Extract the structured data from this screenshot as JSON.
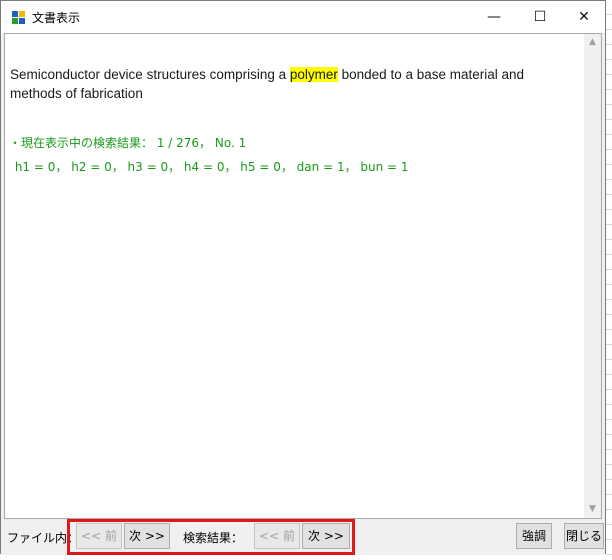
{
  "window": {
    "title": "文書表示",
    "minimize": "—",
    "maximize": "☐",
    "close": "✕"
  },
  "document": {
    "title_before": "Semiconductor device structures comprising a ",
    "title_highlight": "polymer",
    "title_after": " bonded to a base material and methods of fabrication",
    "status_line": "・現在表示中の検索結果： 1 / 276， No. 1",
    "counts_line": " h1 = 0， h2 = 0， h3 = 0， h4 = 0， h5 = 0， dan = 1， bun = 1"
  },
  "bottom": {
    "file_label": "ファイル内：",
    "file_prev": "<< 前",
    "file_next": "次 >>",
    "search_label": "検索結果：",
    "search_prev": "<< 前",
    "search_next": "次 >>",
    "emphasize": "強調",
    "close": "閉じる"
  },
  "colors": {
    "highlight": "#ffff00",
    "status_text": "#1a9a1a",
    "callout_border": "#e0181c"
  },
  "icons": {
    "app": "app-grid-icon",
    "scroll_up": "scroll-up-arrow-icon",
    "scroll_down": "scroll-down-arrow-icon"
  }
}
